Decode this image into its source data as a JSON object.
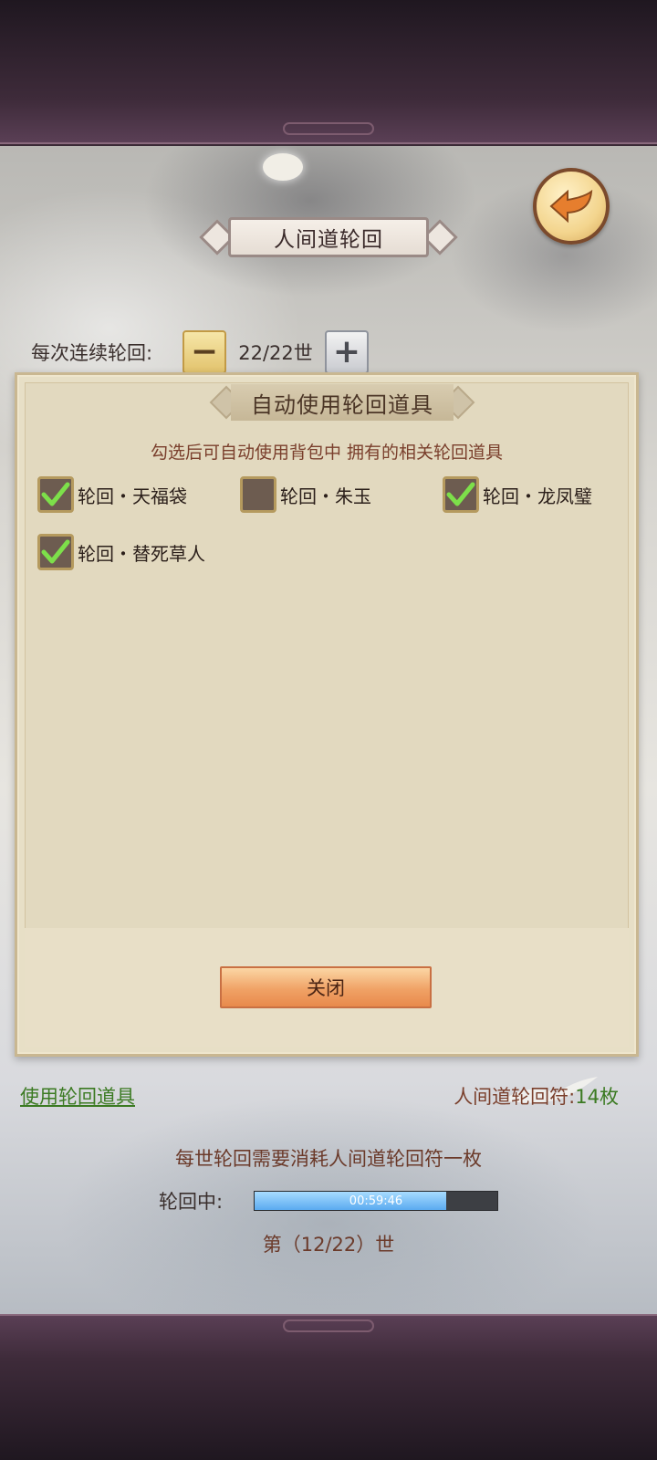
{
  "colors": {
    "accent_green": "#3b7a22",
    "text_brown": "#7a3f2c",
    "progress_fill": "#5aaaf0",
    "button_orange": "#f0a266"
  },
  "header": {
    "title": "人间道轮回",
    "back_icon": "back-arrow-icon"
  },
  "loop": {
    "label": "每次连续轮回:",
    "minus_symbol": "−",
    "plus_symbol": "+",
    "value": "22/22世"
  },
  "dialog": {
    "title": "自动使用轮回道具",
    "description": "勾选后可自动使用背包中 拥有的相关轮回道具",
    "options": [
      {
        "label": "轮回・天福袋",
        "checked": true
      },
      {
        "label": "轮回・朱玉",
        "checked": false
      },
      {
        "label": "轮回・龙凤璧",
        "checked": true
      },
      {
        "label": "轮回・替死草人",
        "checked": true
      }
    ],
    "close_label": "关闭"
  },
  "footer": {
    "use_link": "使用轮回道具",
    "fu_label": "人间道轮回符:",
    "fu_count": "14枚",
    "note": "每世轮回需要消耗人间道轮回符一枚",
    "progress_label": "轮回中:",
    "progress_time": "00:59:46",
    "progress_fraction": 0.79,
    "generation": "第（12/22）世"
  }
}
